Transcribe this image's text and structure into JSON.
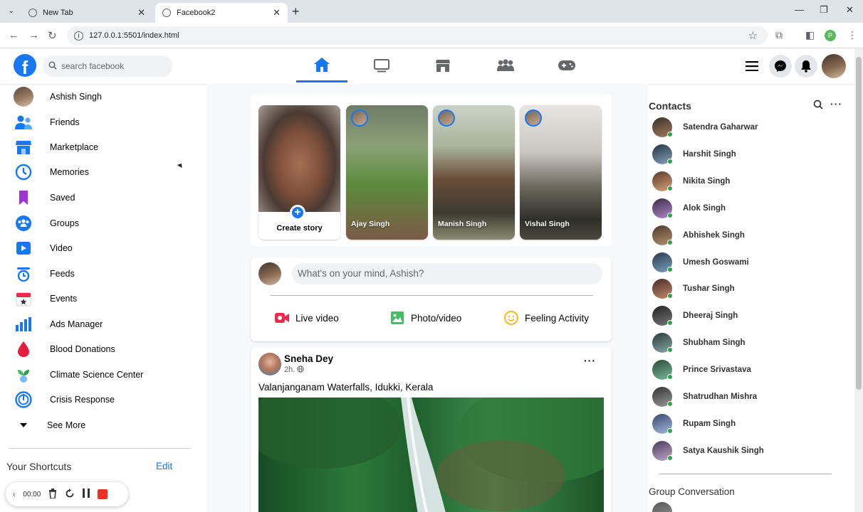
{
  "browser": {
    "tabs": [
      {
        "label": "New Tab",
        "active": false
      },
      {
        "label": "Facebook2",
        "active": true
      }
    ],
    "url": "127.0.0.1:5501/index.html",
    "profile_initial": "P"
  },
  "header": {
    "search_placeholder": "search facebook",
    "nav": [
      "home-icon",
      "watch-icon",
      "marketplace-icon",
      "groups-icon",
      "gaming-icon"
    ],
    "active_nav": "home-icon",
    "accent": "#1877f2"
  },
  "sidebar": {
    "items": [
      {
        "label": "Ashish Singh",
        "icon": "profile-avatar"
      },
      {
        "label": "Friends",
        "icon": "friends-icon"
      },
      {
        "label": "Marketplace",
        "icon": "marketplace-icon"
      },
      {
        "label": "Memories",
        "icon": "memories-icon"
      },
      {
        "label": "Saved",
        "icon": "saved-icon"
      },
      {
        "label": "Groups",
        "icon": "groups-icon"
      },
      {
        "label": "Video",
        "icon": "video-icon"
      },
      {
        "label": "Feeds",
        "icon": "feeds-icon"
      },
      {
        "label": "Events",
        "icon": "events-icon"
      },
      {
        "label": "Ads Manager",
        "icon": "ads-manager-icon"
      },
      {
        "label": "Blood Donations",
        "icon": "blood-drop-icon"
      },
      {
        "label": "Climate Science Center",
        "icon": "climate-icon"
      },
      {
        "label": "Crisis Response",
        "icon": "crisis-icon"
      },
      {
        "label": "See More",
        "icon": "chevron-down-icon"
      }
    ],
    "shortcuts_title": "Your Shortcuts",
    "shortcuts_edit": "Edit"
  },
  "recorder": {
    "time": "00:00"
  },
  "stories": {
    "create_label": "Create story",
    "items": [
      {
        "name": "Ajay Singh"
      },
      {
        "name": "Manish Singh"
      },
      {
        "name": "Vishal Singh"
      }
    ]
  },
  "composer": {
    "placeholder": "What's on your mind, Ashish?",
    "actions": [
      {
        "label": "Live video",
        "icon": "live-video-icon",
        "color": "#f02849"
      },
      {
        "label": "Photo/video",
        "icon": "photo-icon",
        "color": "#45bd62"
      },
      {
        "label": "Feeling Activity",
        "icon": "smiley-icon",
        "color": "#f7b928"
      }
    ]
  },
  "post": {
    "author": "Sneha Dey",
    "time": "2h.",
    "text": "Valanjanganam Waterfalls, Idukki, Kerala"
  },
  "contacts": {
    "title": "Contacts",
    "people": [
      "Satendra Gaharwar",
      "Harshit Singh",
      "Nikita Singh",
      "Alok Singh",
      "Abhishek Singh",
      "Umesh Goswami",
      "Tushar Singh",
      "Dheeraj Singh",
      "Shubham Singh",
      "Prince Srivastava",
      "Shatrudhan Mishra",
      "Rupam Singh",
      "Satya Kaushik Singh"
    ],
    "group_title": "Group Conversation"
  }
}
